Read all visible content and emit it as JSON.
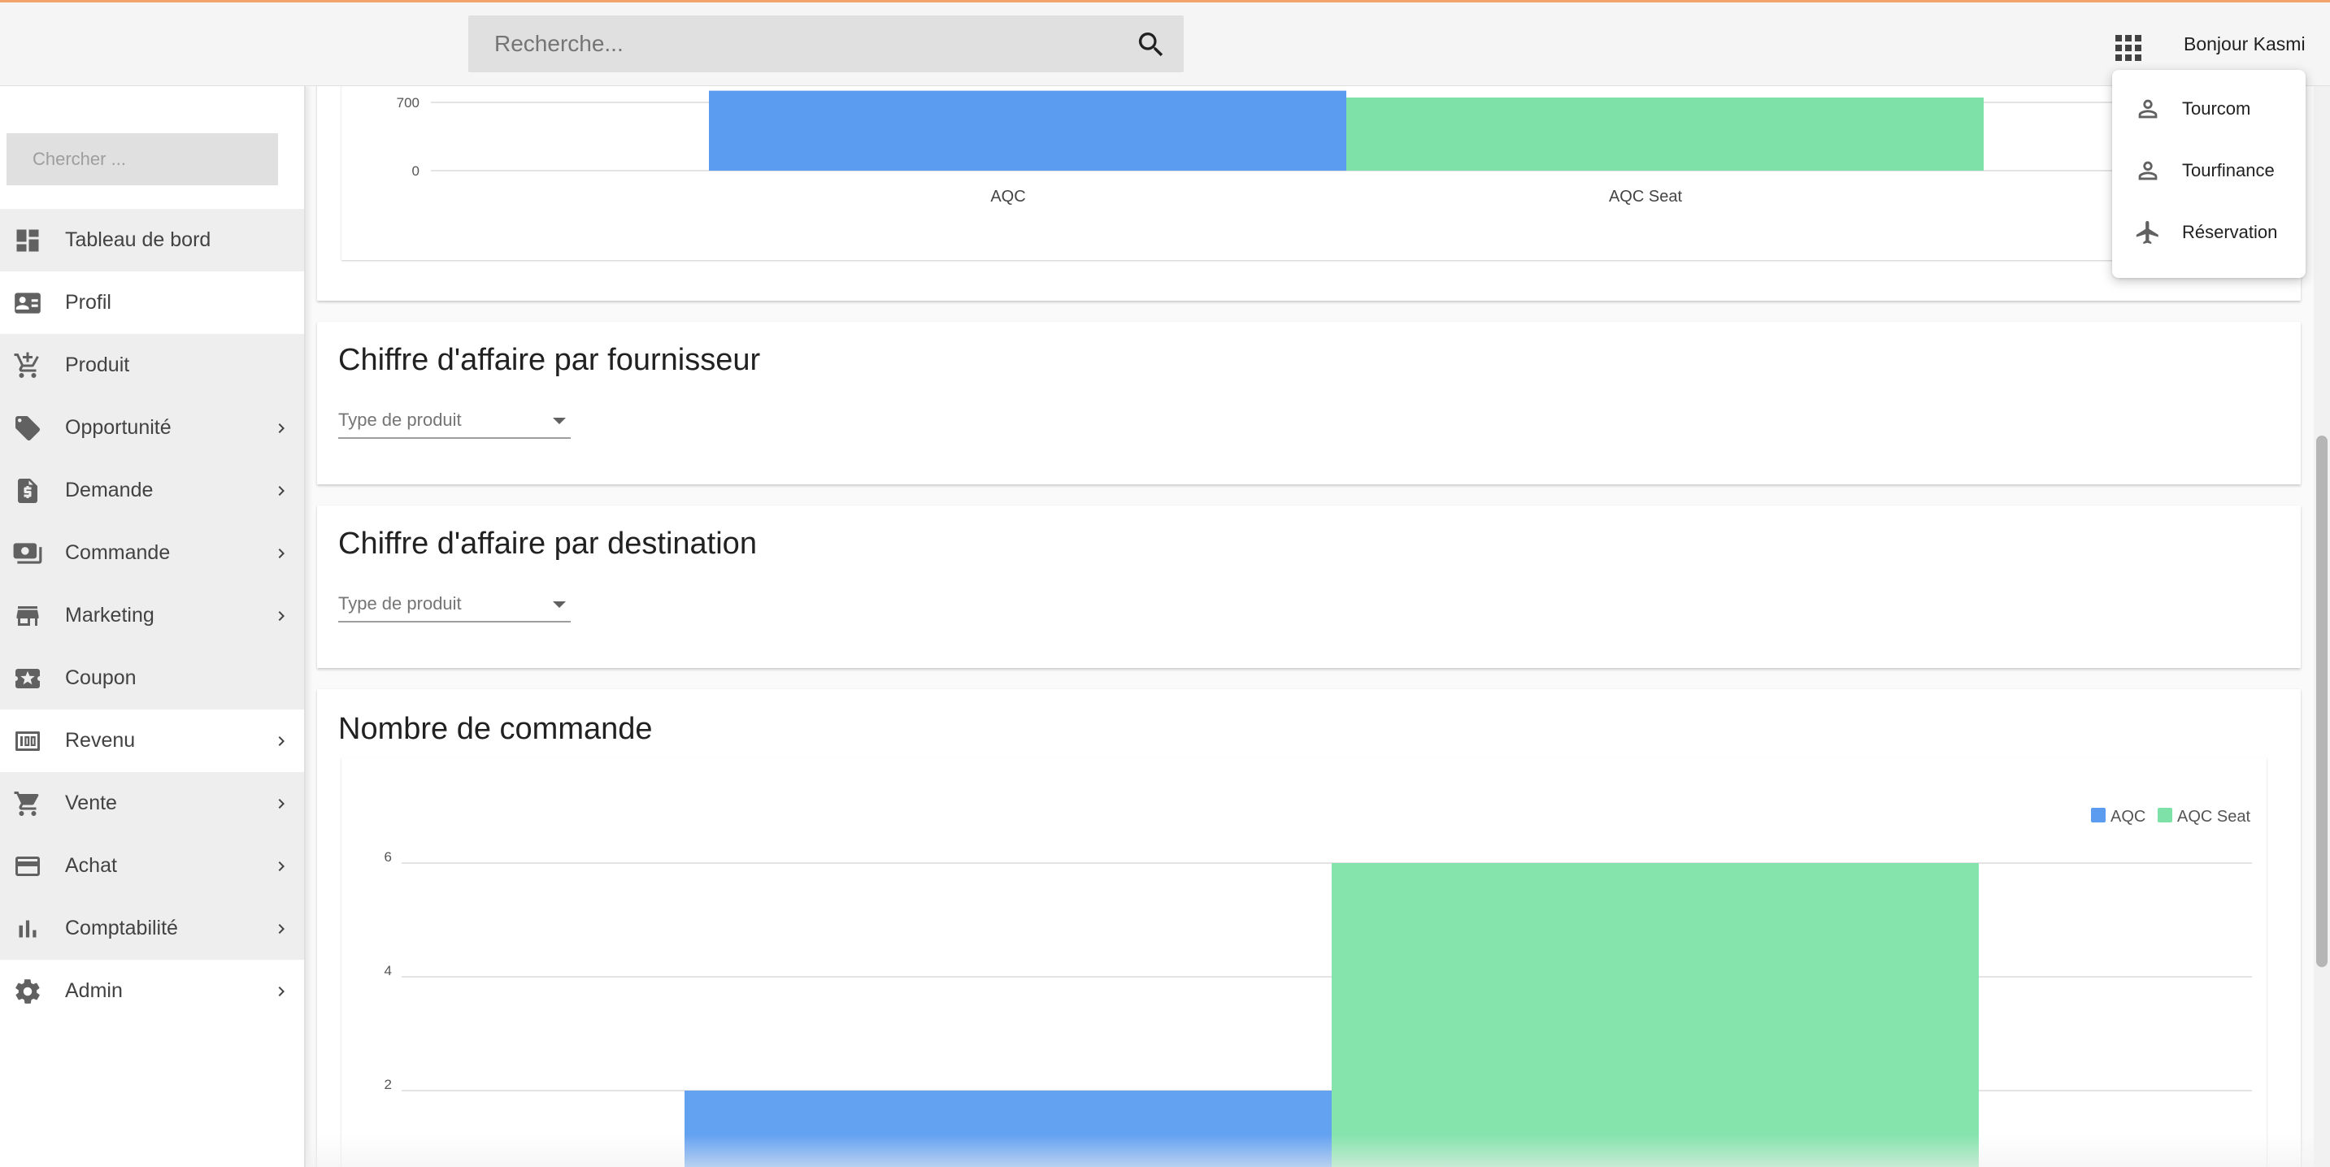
{
  "header": {
    "search_placeholder": "Recherche...",
    "greeting": "Bonjour Kasmi",
    "icons": {
      "search": "search-icon",
      "apps": "apps-grid-icon"
    }
  },
  "app_menu": {
    "items": [
      {
        "label": "Tourcom",
        "icon": "person-icon"
      },
      {
        "label": "Tourfinance",
        "icon": "person-icon"
      },
      {
        "label": "Réservation",
        "icon": "airplane-icon"
      }
    ]
  },
  "sidebar": {
    "search_placeholder": "Chercher ...",
    "items": [
      {
        "label": "Tableau de bord",
        "icon": "dashboard-icon",
        "has_children": false
      },
      {
        "label": "Profil",
        "icon": "profile-card-icon",
        "has_children": false
      },
      {
        "label": "Produit",
        "icon": "cart-add-icon",
        "has_children": false
      },
      {
        "label": "Opportunité",
        "icon": "tag-icon",
        "has_children": true
      },
      {
        "label": "Demande",
        "icon": "invoice-icon",
        "has_children": true
      },
      {
        "label": "Commande",
        "icon": "money-icon",
        "has_children": true
      },
      {
        "label": "Marketing",
        "icon": "store-icon",
        "has_children": true
      },
      {
        "label": "Coupon",
        "icon": "ticket-icon",
        "has_children": false
      },
      {
        "label": "Revenu",
        "icon": "revenue-icon",
        "has_children": true
      },
      {
        "label": "Vente",
        "icon": "cart-icon",
        "has_children": true
      },
      {
        "label": "Achat",
        "icon": "credit-card-icon",
        "has_children": true
      },
      {
        "label": "Comptabilité",
        "icon": "bar-chart-icon",
        "has_children": true
      },
      {
        "label": "Admin",
        "icon": "gear-icon",
        "has_children": true
      }
    ]
  },
  "sections": {
    "fournisseur": {
      "title": "Chiffre d'affaire par fournisseur",
      "select_label": "Type de produit"
    },
    "destination": {
      "title": "Chiffre d'affaire par destination",
      "select_label": "Type de produit"
    },
    "commande": {
      "title": "Nombre de commande"
    }
  },
  "colors": {
    "aqc": "#5b9cf0",
    "aqc_seat": "#7ee2a8",
    "accent_top": "#f1a36b"
  },
  "chart_data": [
    {
      "type": "bar",
      "categories": [
        "AQC",
        "AQC Seat"
      ],
      "values": [
        820,
        750
      ],
      "yticks": [
        0,
        700
      ],
      "ylim": [
        0,
        820
      ],
      "partially_visible": true
    },
    {
      "type": "bar",
      "title": "Nombre de commande",
      "categories": [
        ""
      ],
      "series": [
        {
          "name": "AQC",
          "values": [
            2
          ]
        },
        {
          "name": "AQC Seat",
          "values": [
            6
          ]
        }
      ],
      "yticks": [
        2,
        4,
        6
      ],
      "legend": "top-right",
      "grid": true
    }
  ]
}
